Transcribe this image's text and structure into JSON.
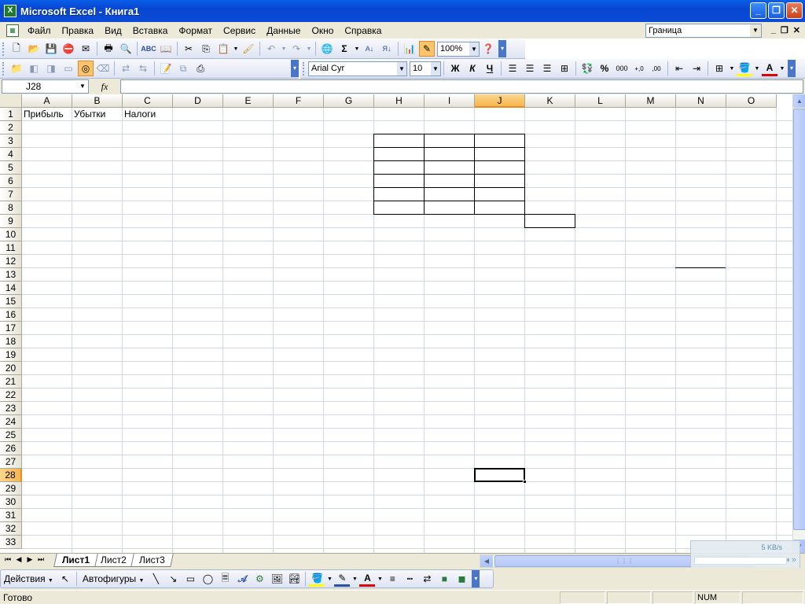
{
  "window": {
    "title": "Microsoft Excel - Книга1",
    "app_icon": "excel-icon",
    "buttons": {
      "minimize": "_",
      "restore": "❐",
      "close": "✕"
    }
  },
  "menubar": {
    "items": [
      "Файл",
      "Правка",
      "Вид",
      "Вставка",
      "Формат",
      "Сервис",
      "Данные",
      "Окно",
      "Справка"
    ],
    "help_box_value": "Граница",
    "mdi": {
      "minimize": "_",
      "restore": "❐",
      "close": "✕"
    }
  },
  "standard_toolbar": {
    "zoom": "100%"
  },
  "formatting_toolbar": {
    "font": "Arial Cyr",
    "font_size": "10",
    "bold": "Ж",
    "italic": "К",
    "underline": "Ч",
    "percent": "%",
    "thousands": "000"
  },
  "formula_bar": {
    "name_box": "J28",
    "fx_label": "fx",
    "formula": ""
  },
  "grid": {
    "columns": [
      "A",
      "B",
      "C",
      "D",
      "E",
      "F",
      "G",
      "H",
      "I",
      "J",
      "K",
      "L",
      "M",
      "N",
      "O"
    ],
    "rows": [
      "1",
      "2",
      "3",
      "4",
      "5",
      "6",
      "7",
      "8",
      "9",
      "10",
      "11",
      "12",
      "13",
      "14",
      "15",
      "16",
      "17",
      "18",
      "19",
      "20",
      "21",
      "22",
      "23",
      "24",
      "25",
      "26",
      "27",
      "28",
      "29",
      "30",
      "31",
      "32",
      "33"
    ],
    "selected_column": "J",
    "selected_row": "28",
    "cells": {
      "A1": "Прибыль",
      "B1": "Убытки",
      "C1": "Налоги"
    }
  },
  "sheets": {
    "tabs": [
      "Лист1",
      "Лист2",
      "Лист3"
    ],
    "active": "Лист1"
  },
  "net_widget": {
    "speed": "5 KB/s"
  },
  "drawing_toolbar": {
    "actions_label": "Действия",
    "autoshapes_label": "Автофигуры"
  },
  "statusbar": {
    "status": "Готово",
    "num": "NUM"
  }
}
